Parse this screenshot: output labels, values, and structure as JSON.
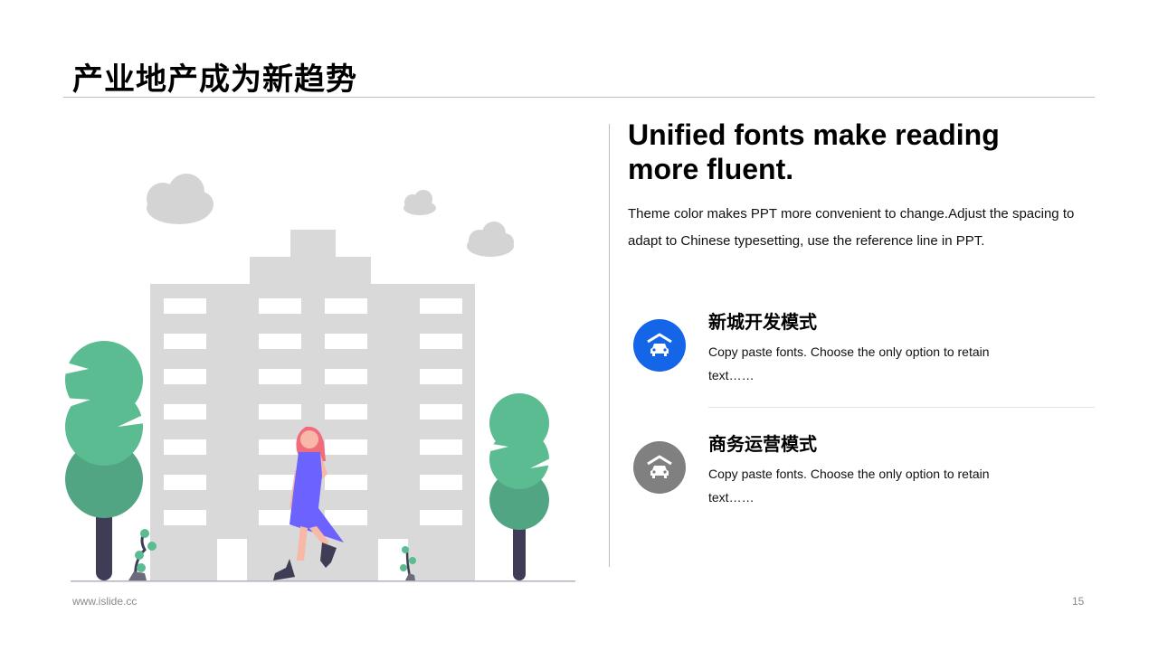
{
  "title": "产业地产成为新趋势",
  "headline": {
    "line1": "Unified fonts make reading",
    "line2": "more fluent."
  },
  "description": "Theme color makes PPT more convenient to change.Adjust the spacing to adapt to Chinese typesetting, use the reference line in PPT.",
  "features": [
    {
      "title": "新城开发模式",
      "text": "Copy paste fonts. Choose the only option to retain text……",
      "icon": "garage-car-icon",
      "color": "#1565e8"
    },
    {
      "title": "商务运营模式",
      "text": "Copy paste fonts. Choose the only option to retain text……",
      "icon": "garage-car-icon",
      "color": "#808080"
    }
  ],
  "footer": {
    "url": "www.islide.cc",
    "page": "15"
  },
  "colors": {
    "accent_blue": "#1565e8",
    "accent_gray": "#808080",
    "tree_green": "#5bbb91",
    "building_gray": "#d9d9d9"
  }
}
